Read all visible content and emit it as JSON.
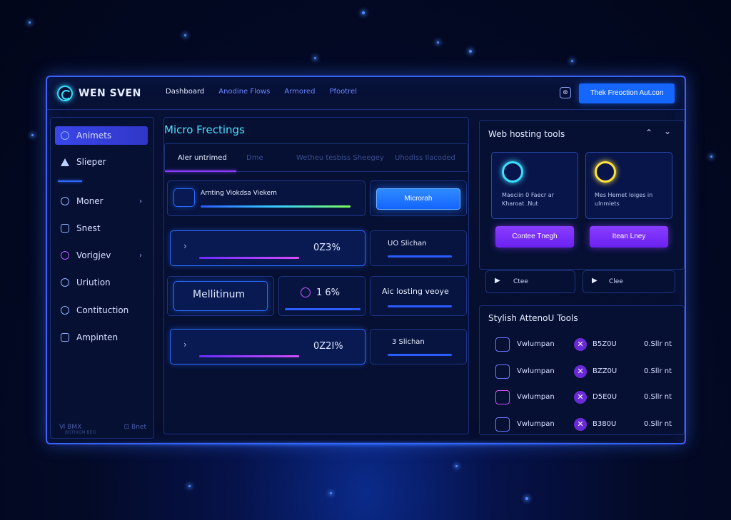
{
  "app": {
    "title": "WEN SVEN"
  },
  "nav": [
    "Dashboard",
    "Anodine Flows",
    "Armored",
    "Pfootrel"
  ],
  "header": {
    "cta": "Thek Freoction Aut.con"
  },
  "sidebar": {
    "items": [
      {
        "label": "Animets",
        "icon": "chart-icon",
        "active": true
      },
      {
        "label": "Slieper",
        "icon": "triangle-icon"
      },
      {
        "label": "Moner",
        "icon": "clock-icon",
        "chevron": true
      },
      {
        "label": "Snest",
        "icon": "square-icon"
      },
      {
        "label": "Vorigjev",
        "icon": "target-icon",
        "chevron": true
      },
      {
        "label": "Uriution",
        "icon": "globe-icon"
      },
      {
        "label": "Contituction",
        "icon": "refresh-icon"
      },
      {
        "label": "Ampinten",
        "icon": "user-icon"
      }
    ],
    "footer_left": "Ⅵ BMX",
    "footer_right": "⊡ Bnet",
    "footer_sub": "BOTHIGM BEO"
  },
  "main": {
    "title": "Micro Frectings",
    "tabs": [
      "Aler untrimed",
      "Dme",
      "Wetheu tesbiss Sheegey",
      "Uhodiss Ilacoded"
    ],
    "card1": {
      "label": "Arnting Viokdsa Viekem",
      "button": "Microrah"
    },
    "card2": {
      "percent": "0Z3%",
      "side_label": "UO Slichan"
    },
    "card3": {
      "box_label": "Mellitinum",
      "percent": "1 6%",
      "side_label": "Aic losting veoye"
    },
    "card4": {
      "percent": "0Z2I%",
      "side_label": "3 Slichan"
    }
  },
  "right": {
    "title": "Web hosting tools",
    "tool1": {
      "text": "Maeciin 0 Faecr ar Kharoat .Nut",
      "button": "Contee Tnegh",
      "link": "Ctee"
    },
    "tool2": {
      "text": "Mes Hemet loiges in ulnmiets",
      "button": "Itean Lney",
      "link": "Clee"
    },
    "section_title": "Stylish AttenoU Tools",
    "rows": [
      {
        "name": "Vwlumpan",
        "value": "B5Z0U",
        "status": "0.Sllr nt"
      },
      {
        "name": "Vwlumpan",
        "value": "BZZ0U",
        "status": "0.Sllr nt"
      },
      {
        "name": "Vwlumpan",
        "value": "D5E0U",
        "status": "0.Sllr nt"
      },
      {
        "name": "Vwlumpan",
        "value": "B380U",
        "status": "0.Sllr nt"
      }
    ]
  },
  "colors": {
    "accent": "#1466ff",
    "purple": "#8a3dff",
    "cyan": "#3ce0ff",
    "yellow": "#ffe23a"
  }
}
